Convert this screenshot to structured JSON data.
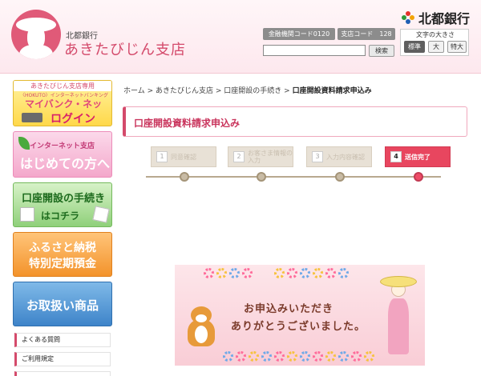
{
  "header": {
    "bank_small": "北都銀行",
    "branch_name": "あきたびじん支店",
    "corp_name": "北都銀行",
    "bank_code": "金融機関コード0120",
    "branch_code": "支店コード　128",
    "search_button": "検索",
    "fontsize_label": "文字の大きさ",
    "fontsize_options": [
      "標準",
      "大",
      "特大"
    ]
  },
  "sidebar": {
    "mybank": {
      "tag": "あきたびじん支店専用",
      "sub": "〈HOKUTO〉インターネットバンキング",
      "title": "マイバンク・ネット",
      "login": "ログイン"
    },
    "beginners": {
      "small": "インターネット支店",
      "big": "はじめての方へ"
    },
    "account": {
      "t1": "口座開設の手続き",
      "t2": "はコチラ"
    },
    "furusato": {
      "t1": "ふるさと納税",
      "t2": "特別定期預金"
    },
    "products": {
      "t1": "お取扱い商品"
    },
    "links": [
      "よくある質問",
      "ご利用規定"
    ]
  },
  "main": {
    "breadcrumb": [
      "ホーム",
      "あきたびじん支店",
      "口座開設の手続き",
      "口座開設資料請求申込み"
    ],
    "breadcrumb_sep": " > ",
    "page_title": "口座開設資料請求申込み",
    "steps": [
      {
        "num": "1",
        "label": "同意確認",
        "active": false
      },
      {
        "num": "2",
        "label": "お客さま情報の入力",
        "active": false
      },
      {
        "num": "3",
        "label": "入力内容確認",
        "active": false
      },
      {
        "num": "4",
        "label": "送信完了",
        "active": true
      }
    ],
    "thanks_line1": "お申込みいただき",
    "thanks_line2": "ありがとうございました。"
  },
  "colors": {
    "accent": "#d44a6b",
    "active_step": "#e8465f",
    "inactive_step": "#e8e1d6"
  }
}
